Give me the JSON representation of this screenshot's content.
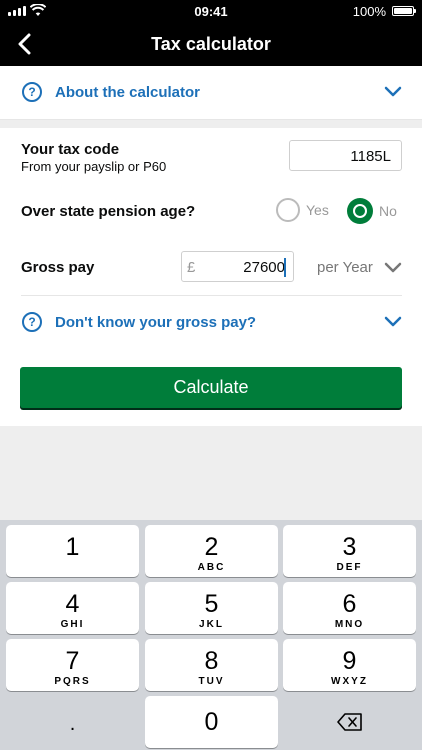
{
  "status_bar": {
    "time": "09:41",
    "battery": "100%",
    "battery_level": 1.0
  },
  "nav": {
    "title": "Tax calculator",
    "back_icon": "chevron-left-icon"
  },
  "about": {
    "label": "About the calculator",
    "help_icon": "?",
    "chevron_icon": "chevron-down-icon"
  },
  "tax_code": {
    "label": "Your tax code",
    "sublabel": "From your payslip or P60",
    "value": "1185L"
  },
  "pension": {
    "label": "Over state pension age?",
    "yes_label": "Yes",
    "no_label": "No",
    "selected": "No"
  },
  "gross_pay": {
    "label": "Gross pay",
    "currency": "£",
    "value": "27600",
    "period": "per Year"
  },
  "dont_know": {
    "label": "Don't know your gross pay?",
    "help_icon": "?"
  },
  "calculate": {
    "label": "Calculate"
  },
  "colors": {
    "link": "#1d70b8",
    "button": "#007d3a",
    "header": "#000000",
    "keyboard_bg": "#d1d4d9"
  },
  "keypad": {
    "rows": [
      [
        {
          "num": "1",
          "letters": ""
        },
        {
          "num": "2",
          "letters": "ABC"
        },
        {
          "num": "3",
          "letters": "DEF"
        }
      ],
      [
        {
          "num": "4",
          "letters": "GHI"
        },
        {
          "num": "5",
          "letters": "JKL"
        },
        {
          "num": "6",
          "letters": "MNO"
        }
      ],
      [
        {
          "num": "7",
          "letters": "PQRS"
        },
        {
          "num": "8",
          "letters": "TUV"
        },
        {
          "num": "9",
          "letters": "WXYZ"
        }
      ]
    ],
    "dot": ".",
    "zero": "0",
    "delete_icon": "backspace-icon"
  }
}
